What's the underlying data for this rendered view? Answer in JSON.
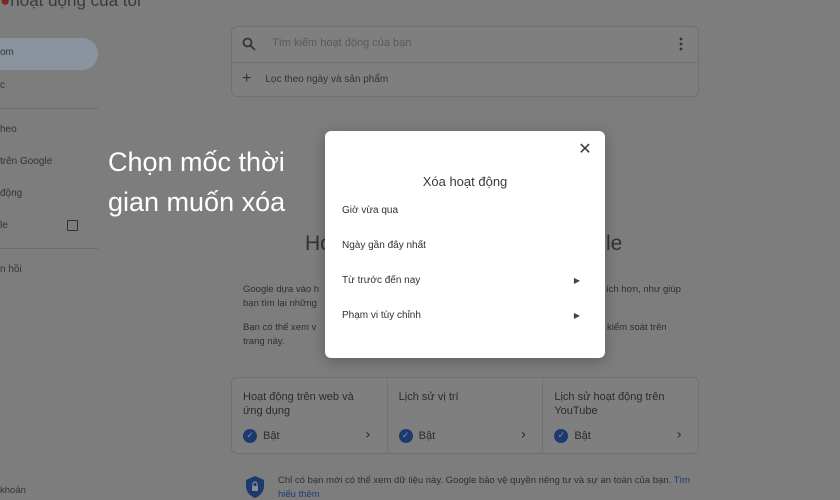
{
  "app": {
    "title": "hoạt động của tôi"
  },
  "sidebar": {
    "items": [
      {
        "label": "om"
      },
      {
        "label": "c"
      },
      {
        "label": "heo"
      },
      {
        "label": "trên Google"
      },
      {
        "label": "động"
      },
      {
        "label": "le"
      },
      {
        "label": "n hồi"
      }
    ],
    "footer": "khoản"
  },
  "search": {
    "placeholder": "Tìm kiếm hoạt động của bạn",
    "filter_label": "Lọc theo ngày và sản phẩm"
  },
  "hero": {
    "heading_left": "Ho",
    "heading_right": "le",
    "text1_left": [
      "Google dựa vào h",
      "bạn tìm lại những"
    ],
    "text1_right": [
      "ích hơn, như giúp"
    ],
    "text2_left": [
      "Bạn có thể xem v",
      "trang này."
    ],
    "text2_right": [
      "kiểm soát trên"
    ]
  },
  "cards": [
    {
      "title": "Hoạt động trên web và ứng dụng",
      "status": "Bật"
    },
    {
      "title": "Lịch sử vị trí",
      "status": "Bật"
    },
    {
      "title": "Lịch sử hoạt động trên YouTube",
      "status": "Bật"
    }
  ],
  "privacy": {
    "text": "Chỉ có bạn mới có thể xem dữ liệu này. Google bảo vệ quyền riêng tư và sự an toàn của bạn.",
    "link": "Tìm hiểu thêm"
  },
  "caption": "Chọn mốc thời gian muốn xóa",
  "dialog": {
    "title": "Xóa hoạt động",
    "options": [
      {
        "label": "Giờ vừa qua"
      },
      {
        "label": "Ngày gần đây nhất"
      },
      {
        "label": "Từ trước đến nay"
      },
      {
        "label": "Phạm vi tùy chỉnh"
      }
    ]
  },
  "colors": {
    "overlay": "#7b7b7b",
    "dialog_bg": "#ffffff",
    "caption": "#ffffff",
    "accent": "#1d3a70"
  }
}
